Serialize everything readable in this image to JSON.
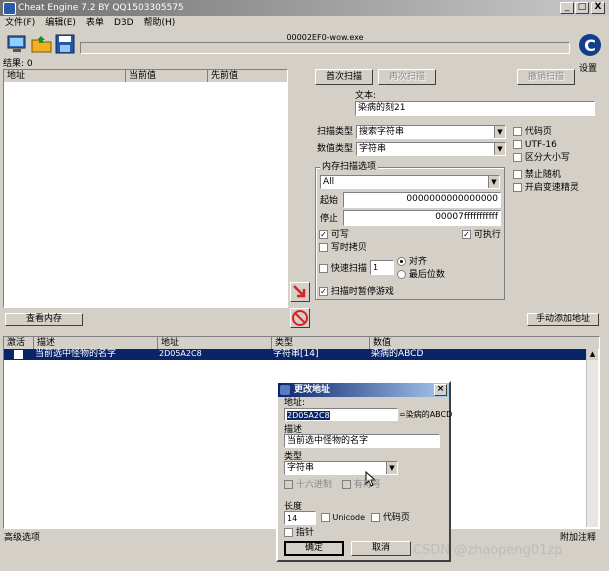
{
  "window": {
    "title": "Cheat Engine 7.2 BY QQ1503305575",
    "minimize": "_",
    "maximize": "□",
    "close": "X"
  },
  "menu": [
    "文件(F)",
    "编辑(E)",
    "表单",
    "D3D",
    "帮助(H)"
  ],
  "process_name": "00002EF0-wow.exe",
  "settings_label": "设置",
  "results_label": "结果: 0",
  "results_columns": [
    "地址",
    "当前值",
    "先前值"
  ],
  "scan": {
    "first_scan": "首次扫描",
    "next_scan": "再次扫描",
    "undo_scan": "撤销扫描",
    "text_label": "文本:",
    "text_value": "染病的刻21",
    "scan_type_label": "扫描类型",
    "scan_type_value": "搜索字符串",
    "value_type_label": "数值类型",
    "value_type_value": "字符串",
    "memory_options_label": "内存扫描选项",
    "region_value": "All",
    "start_label": "起始",
    "start_value": "0000000000000000",
    "stop_label": "停止",
    "stop_value": "00007fffffffffff",
    "writable": "可写",
    "executable": "可执行",
    "copy_on_write": "写时拷贝",
    "fast_scan": "快速扫描",
    "fast_scan_value": "1",
    "align": "对齐",
    "last_digits": "最后位数",
    "pause_game": "扫描时暂停游戏",
    "codepage": "代码页",
    "utf16": "UTF-16",
    "case_sensitive": "区分大小写",
    "no_random": "禁止随机",
    "speedhack": "开启变速精灵"
  },
  "view_memory": "查看内存",
  "add_address_manually": "手动添加地址",
  "cheat_table": {
    "columns": [
      "激活",
      "描述",
      "地址",
      "类型",
      "数值"
    ],
    "rows": [
      {
        "description": "当前选中怪物的名字",
        "address": "2D05A2C8",
        "type": "字符串[14]",
        "value": "染病的ABCD"
      }
    ]
  },
  "footer": {
    "advanced": "高级选项",
    "extras": "附加注释"
  },
  "dialog": {
    "title": "更改地址",
    "address_label": "地址:",
    "address_value": "2D05A2C8",
    "address_result": "=染病的ABCD",
    "description_label": "描述",
    "description_value": "当前选中怪物的名字",
    "type_label": "类型",
    "type_value": "字符串",
    "hex": "十六进制",
    "signed": "有符号",
    "length_label": "长度",
    "length_value": "14",
    "unicode": "Unicode",
    "codepage": "代码页",
    "pointer": "指针",
    "ok": "确定",
    "cancel": "取消"
  },
  "watermark": "CSDN @zhaopeng01zp"
}
